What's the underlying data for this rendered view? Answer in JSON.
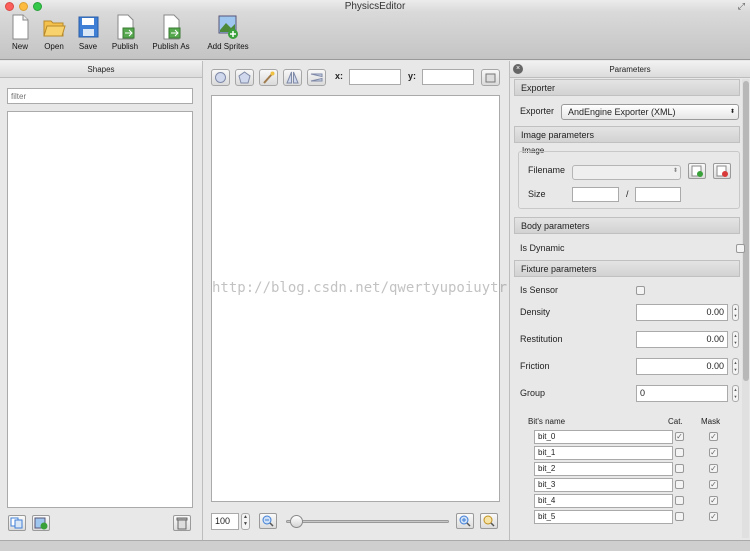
{
  "window": {
    "title": "PhysicsEditor"
  },
  "toolbar": {
    "new": "New",
    "open": "Open",
    "save": "Save",
    "publish": "Publish",
    "publish_as": "Publish As",
    "add_sprites": "Add Sprites"
  },
  "shapes": {
    "title": "Shapes",
    "filter_placeholder": "filter"
  },
  "canvas": {
    "x_label": "x:",
    "y_label": "y:",
    "zoom": "100"
  },
  "params": {
    "title": "Parameters",
    "exporter_section": "Exporter",
    "exporter_label": "Exporter",
    "exporter_value": "AndEngine Exporter (XML)",
    "image_section": "Image parameters",
    "image_group": "Image",
    "filename_label": "Filename",
    "size_label": "Size",
    "size_sep": "/",
    "body_section": "Body parameters",
    "is_dynamic_label": "Is Dynamic",
    "fixture_section": "Fixture parameters",
    "is_sensor_label": "Is Sensor",
    "density_label": "Density",
    "density_value": "0.00",
    "restitution_label": "Restitution",
    "restitution_value": "0.00",
    "friction_label": "Friction",
    "friction_value": "0.00",
    "group_label": "Group",
    "group_value": "0",
    "bits_header": {
      "name": "Bit's name",
      "cat": "Cat.",
      "mask": "Mask"
    },
    "bits": [
      {
        "name": "bit_0",
        "cat": true,
        "mask": true
      },
      {
        "name": "bit_1",
        "cat": false,
        "mask": true
      },
      {
        "name": "bit_2",
        "cat": false,
        "mask": true
      },
      {
        "name": "bit_3",
        "cat": false,
        "mask": true
      },
      {
        "name": "bit_4",
        "cat": false,
        "mask": true
      },
      {
        "name": "bit_5",
        "cat": false,
        "mask": true
      }
    ]
  },
  "watermark": "http://blog.csdn.net/qwertyupoiuytr",
  "colors": {
    "close": "#fc605c",
    "minimize": "#fdbc40",
    "zoom": "#34c84a",
    "accent_blue": "#3f7fd6"
  }
}
